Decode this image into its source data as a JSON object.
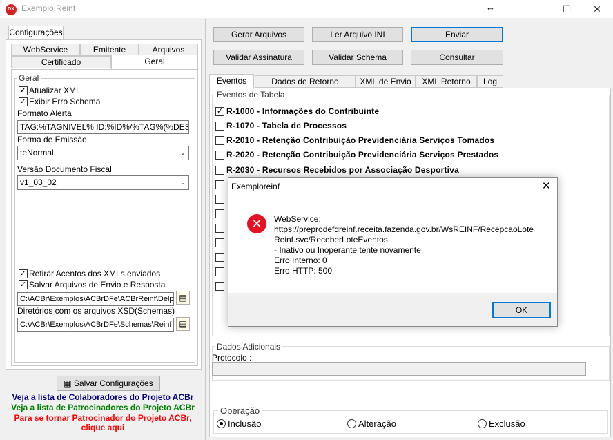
{
  "window": {
    "title": "Exemplo Reinf",
    "icon_text": "DX",
    "resize_icon": "↔"
  },
  "left": {
    "group_tab": "Configurações",
    "tabs_row1": [
      "WebService",
      "Emitente",
      "Arquivos"
    ],
    "tabs_row2": [
      "Certificado",
      "Geral"
    ],
    "geral_title": "Geral",
    "chk_atualizar_xml": "Atualizar XML",
    "chk_exibir_erro": "Exibir Erro Schema",
    "formato_alerta_label": "Formato Alerta",
    "formato_alerta_value": "TAG:%TAGNIVEL% ID:%ID%/%TAG%(%DESCRI",
    "forma_emissao_label": "Forma de Emissão",
    "forma_emissao_value": "teNormal",
    "versao_label": "Versão Documento Fiscal",
    "versao_value": "v1_03_02",
    "chk_retirar_acentos": "Retirar Acentos dos XMLs enviados",
    "chk_salvar_arquivos": "Salvar Arquivos de Envio e Resposta",
    "path_envio": "C:\\ACBr\\Exemplos\\ACBrDFe\\ACBrReinf\\Delphi",
    "dir_schemas_label": "Diretórios com os arquivos XSD(Schemas)",
    "path_schemas": "C:\\ACBr\\Exemplos\\ACBrDFe\\Schemas\\Reinf",
    "salvar_button": "Salvar Configurações",
    "link_colaboradores": "Veja a lista de Colaboradores do Projeto ACBr",
    "link_patrocinadores": "Veja a lista de Patrocinadores do Projeto ACBr",
    "link_tornar_1": "Para se tornar Patrocinador do Projeto ACBr,",
    "link_tornar_2": "clique aqui"
  },
  "toolbar": {
    "gerar_arquivos": "Gerar Arquivos",
    "ler_arquivo_ini": "Ler Arquivo INI",
    "enviar": "Enviar",
    "validar_assinatura": "Validar Assinatura",
    "validar_schema": "Validar Schema",
    "consultar": "Consultar"
  },
  "right": {
    "tabs": [
      "Eventos",
      "Dados de Retorno Eventos",
      "XML de Envio",
      "XML Retorno",
      "Log"
    ],
    "eventos_tabela_title": "Eventos de Tabela",
    "events": [
      {
        "label": "R-1000 - Informações do Contribuinte",
        "checked": true
      },
      {
        "label": "R-1070 - Tabela de Processos",
        "checked": false
      },
      {
        "label": "R-2010 - Retenção Contribuição Previdenciária  Serviços Tomados",
        "checked": false
      },
      {
        "label": "R-2020 - Retenção Contribuição Previdenciária  Serviços Prestados",
        "checked": false
      },
      {
        "label": "R-2030 - Recursos Recebidos por Associação Desportiva",
        "checked": false
      }
    ],
    "dados_adicionais_title": "Dados Adicionais",
    "protocolo_label": "Protocolo :",
    "protocolo_value": "",
    "operacao_title": "Operação",
    "radio_inclusao": "Inclusão",
    "radio_alteracao": "Alteração",
    "radio_exclusao": "Exclusão"
  },
  "dialog": {
    "title": "Exemploreinf",
    "line1": "WebService:",
    "line2": "https://preprodefdreinf.receita.fazenda.gov.br/WsREINF/RecepcaoLote",
    "line3": "Reinf.svc/ReceberLoteEventos",
    "line4": "- Inativo ou Inoperante tente novamente.",
    "line5": "Erro Interno: 0",
    "line6": "Erro HTTP: 500",
    "ok_button": "OK"
  },
  "colors": {
    "link_blue": "#000080",
    "link_green": "#008000",
    "link_red": "#ff0000",
    "error_red": "#e81123",
    "focus_blue": "#0078d7"
  }
}
